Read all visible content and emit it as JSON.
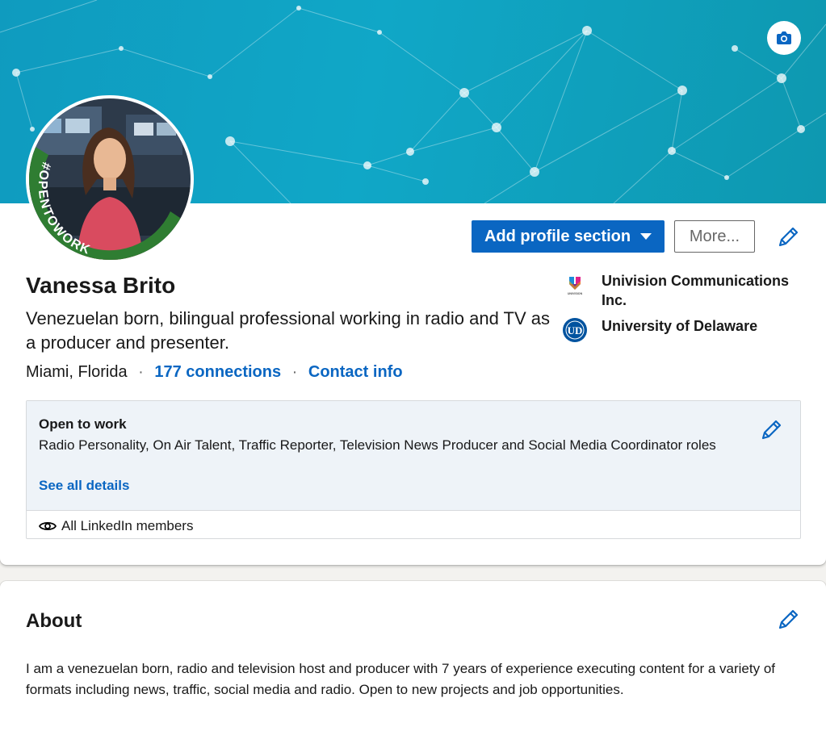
{
  "profile": {
    "name": "Vanessa Brito",
    "headline": "Venezuelan born, bilingual professional working in radio and TV as a producer and presenter.",
    "location": "Miami, Florida",
    "separator": "·",
    "connections_label": "177 connections",
    "contact_info_label": "Contact info",
    "avatar_frame_text": "#OPENTOWORK",
    "icons": {
      "banner_edit": "camera-icon",
      "edit": "pencil-icon",
      "visibility": "eye-icon",
      "dropdown": "caret-down-icon"
    }
  },
  "actions": {
    "add_section_label": "Add profile section",
    "more_label": "More..."
  },
  "organizations": [
    {
      "name": "Univision Communications Inc.",
      "logo": "univision-logo",
      "logo_caption": "UNIVISION"
    },
    {
      "name": "University of Delaware",
      "logo": "university-of-delaware-logo",
      "logo_text": "UD"
    }
  ],
  "open_to_work": {
    "title": "Open to work",
    "description": "Radio Personality, On Air Talent, Traffic Reporter, Television News Producer and Social Media Coordinator roles",
    "details_link": "See all details",
    "visibility": "All LinkedIn members"
  },
  "about": {
    "title": "About",
    "text": "I am a venezuelan born, radio and television host and producer with 7 years of experience executing content for a variety of formats including news, traffic, social media and radio. Open to new projects and job opportunities."
  },
  "colors": {
    "accent": "#0a66c2",
    "banner": "#10a7c7",
    "open_to_work_green": "#2f7d32",
    "open_to_work_background": "#eef3f8"
  }
}
